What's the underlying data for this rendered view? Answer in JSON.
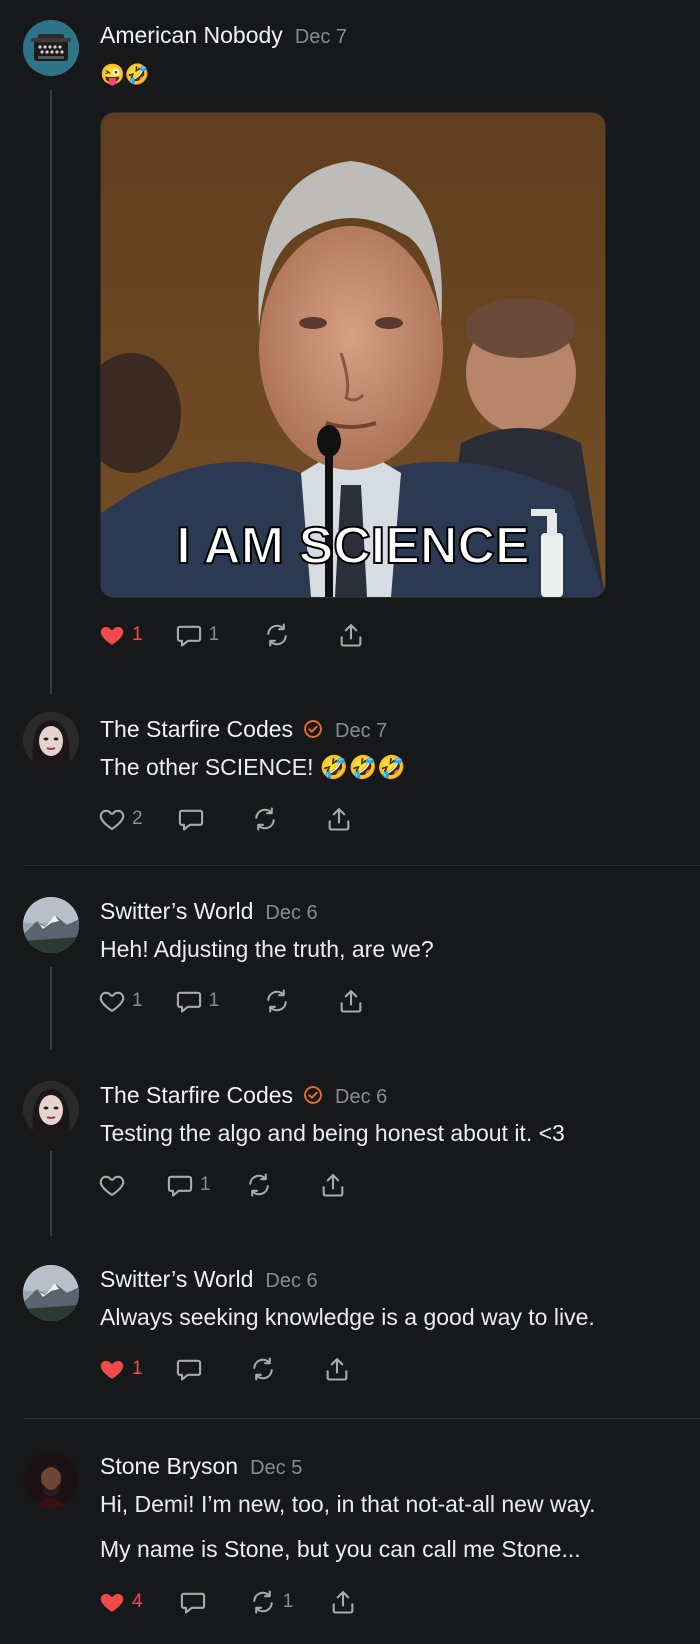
{
  "posts": [
    {
      "author": "American Nobody",
      "date": "Dec 7",
      "text": "😜🤣",
      "likes": "1",
      "comments": "1",
      "reposts": "",
      "liked": true,
      "image_caption": "I AM SCIENCE",
      "verified": false
    },
    {
      "author": "The Starfire Codes",
      "date": "Dec 7",
      "text": "The other SCIENCE! 🤣🤣🤣",
      "likes": "2",
      "comments": "",
      "reposts": "",
      "liked": false,
      "verified": true
    },
    {
      "author": "Switter’s World",
      "date": "Dec 6",
      "text": "Heh! Adjusting the truth, are we?",
      "likes": "1",
      "comments": "1",
      "reposts": "",
      "liked": false,
      "verified": false
    },
    {
      "author": "The Starfire Codes",
      "date": "Dec 6",
      "text": "Testing the algo and being honest about it. <3",
      "likes": "",
      "comments": "1",
      "reposts": "",
      "liked": false,
      "verified": true
    },
    {
      "author": "Switter’s World",
      "date": "Dec 6",
      "text": "Always seeking knowledge is a good way to live.",
      "likes": "1",
      "comments": "",
      "reposts": "",
      "liked": true,
      "verified": false
    },
    {
      "author": "Stone Bryson",
      "date": "Dec 5",
      "text": "Hi, Demi! I’m new, too, in that not-at-all new way.",
      "text2": "My name is Stone, but you can call me Stone...",
      "likes": "4",
      "comments": "",
      "reposts": "1",
      "liked": true,
      "verified": false
    }
  ],
  "colors": {
    "background": "#17181a",
    "accent_like": "#f04a4a",
    "verified": "#f0702a",
    "muted": "#8b8c91"
  },
  "icons": [
    "heart-icon",
    "comment-icon",
    "repost-icon",
    "share-icon",
    "verified-badge-icon"
  ]
}
